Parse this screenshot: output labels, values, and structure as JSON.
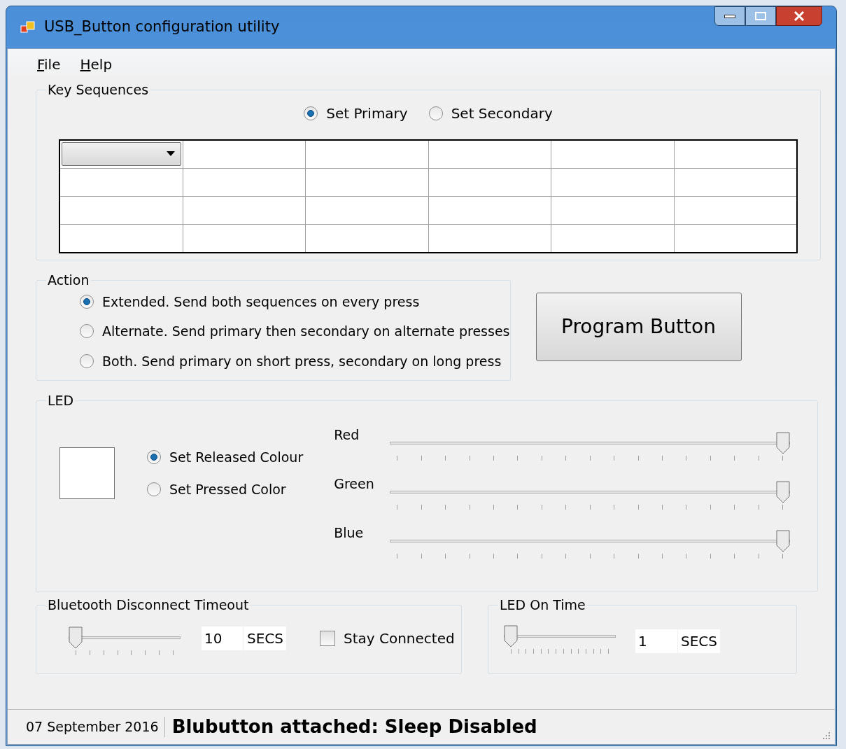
{
  "window": {
    "title": "USB_Button configuration utility"
  },
  "menu": [
    {
      "label": "File"
    },
    {
      "label": "Help"
    }
  ],
  "key_sequences": {
    "title": "Key Sequences",
    "modes": [
      {
        "label": "Set Primary",
        "selected": true
      },
      {
        "label": "Set Secondary",
        "selected": false
      }
    ]
  },
  "action": {
    "title": "Action",
    "options": [
      {
        "label": "Extended. Send both sequences on every press",
        "selected": true
      },
      {
        "label": "Alternate. Send primary then secondary on alternate presses",
        "selected": false
      },
      {
        "label": "Both. Send primary on short press, secondary on long press",
        "selected": false
      }
    ]
  },
  "program_button": "Program Button",
  "led": {
    "title": "LED",
    "modes": [
      {
        "label": "Set Released Colour",
        "selected": true
      },
      {
        "label": "Set Pressed Color",
        "selected": false
      }
    ],
    "channels": [
      {
        "label": "Red",
        "level": 1
      },
      {
        "label": "Green",
        "level": 1
      },
      {
        "label": "Blue",
        "level": 1
      }
    ]
  },
  "bt_timeout": {
    "title": "Bluetooth Disconnect Timeout",
    "level": 0,
    "value": "10",
    "unit": "SECS",
    "stay_connected": {
      "label": "Stay Connected",
      "checked": false
    }
  },
  "led_on_time": {
    "title": "LED On Time",
    "level": 0,
    "value": "1",
    "unit": "SECS"
  },
  "status_bar": {
    "date": "07 September 2016",
    "message": "Blubutton attached: Sleep Disabled"
  }
}
